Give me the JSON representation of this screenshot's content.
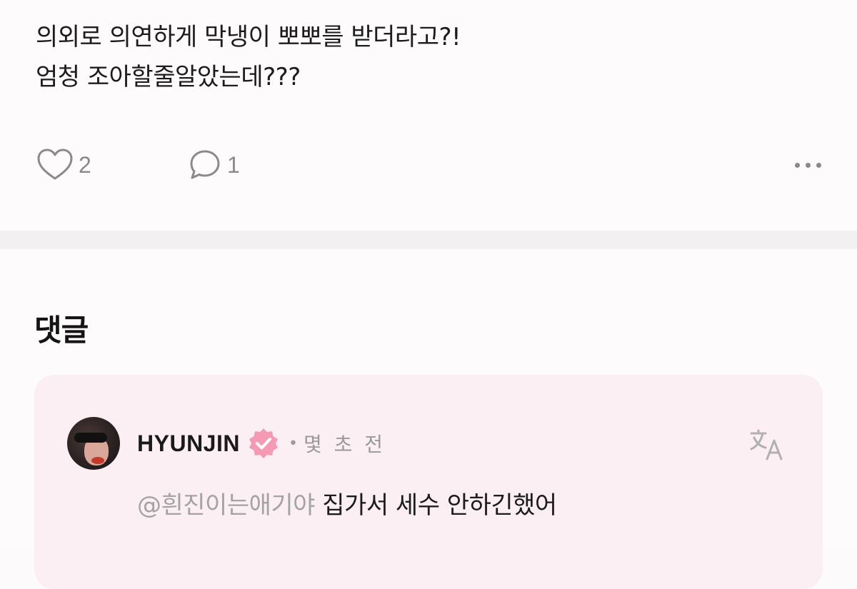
{
  "post": {
    "lines": [
      "의외로 의연하게 막냉이 뽀뽀를 받더라고?!",
      "엄청 조아할줄알았는데???"
    ],
    "like_count": "2",
    "comment_count": "1"
  },
  "comments": {
    "title": "댓글",
    "items": [
      {
        "username": "HYUNJIN",
        "time": "몇 초 전",
        "mention": "@흰진이는애기야",
        "text": "집가서 세수 안하긴했어"
      }
    ]
  },
  "icons": {
    "like": "heart-icon",
    "comment": "speech-bubble-icon",
    "more": "more-dots-icon",
    "verified": "verified-badge-icon",
    "translate": "translate-icon"
  },
  "colors": {
    "card_background": "#fbeff3",
    "verified_badge": "#f59ab5",
    "muted_text": "#9a9a9a"
  }
}
